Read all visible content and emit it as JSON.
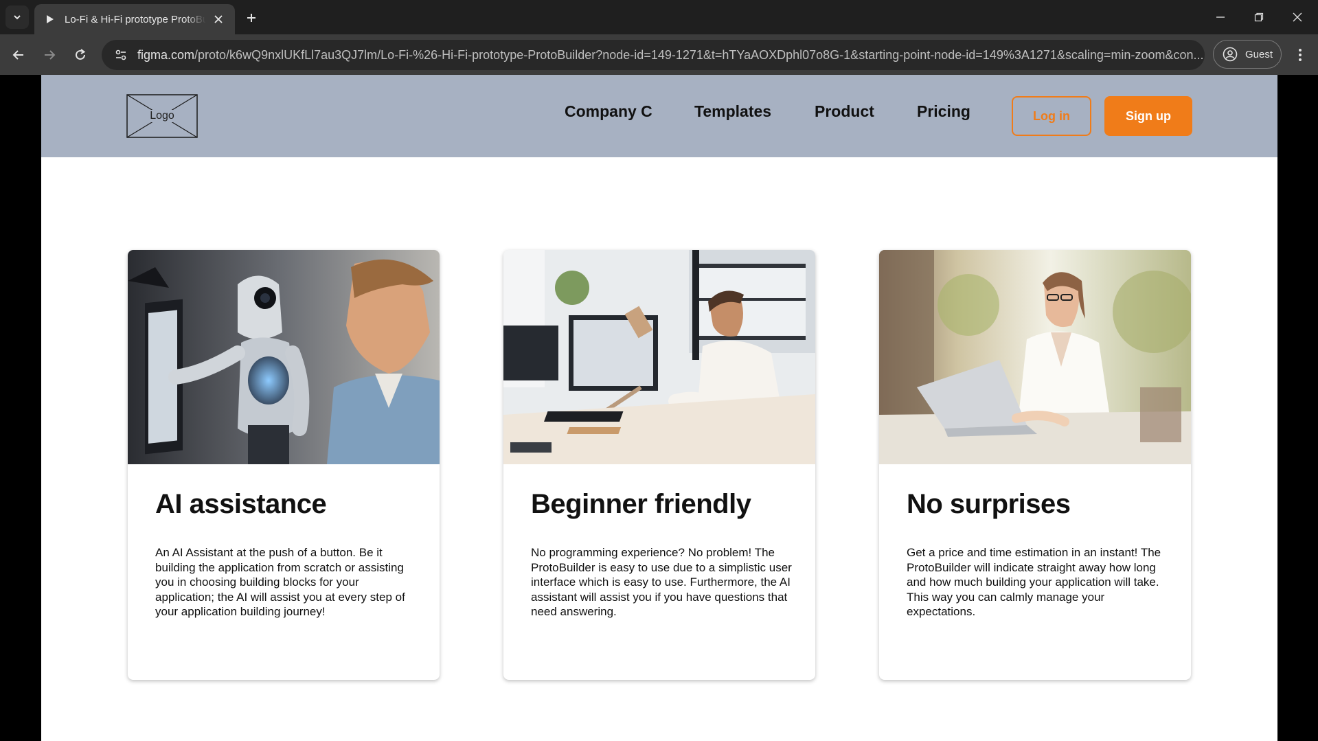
{
  "browser": {
    "tab_title": "Lo-Fi & Hi-Fi prototype ProtoBuilder",
    "url_host": "figma.com",
    "url_path": "/proto/k6wQ9nxlUKfLl7au3QJ7lm/Lo-Fi-%26-Hi-Fi-prototype-ProtoBuilder?node-id=149-1271&t=hTYaAOXDphl07o8G-1&starting-point-node-id=149%3A1271&scaling=min-zoom&con...",
    "profile_label": "Guest"
  },
  "header": {
    "logo_label": "Logo",
    "nav": [
      "Company C",
      "Templates",
      "Product",
      "Pricing"
    ],
    "login_label": "Log in",
    "signup_label": "Sign up",
    "background_color": "#a7b1c2",
    "accent_color": "#f07c19"
  },
  "cards": [
    {
      "title": "AI assistance",
      "body": "An AI Assistant at the push of a button. Be it building the application from scratch or assisting you in choosing building blocks for your application; the AI will assist you at every step of your application building journey!"
    },
    {
      "title": "Beginner friendly",
      "body": "No programming experience? No problem! The ProtoBuilder is easy to use due to a simplistic user interface which is easy to use. Furthermore, the AI assistant will assist you if you have questions that need answering."
    },
    {
      "title": "No surprises",
      "body": "Get a price and time estimation in an instant! The ProtoBuilder will indicate straight away how long and how much building your application will take. This way you can calmly manage your expectations."
    }
  ]
}
